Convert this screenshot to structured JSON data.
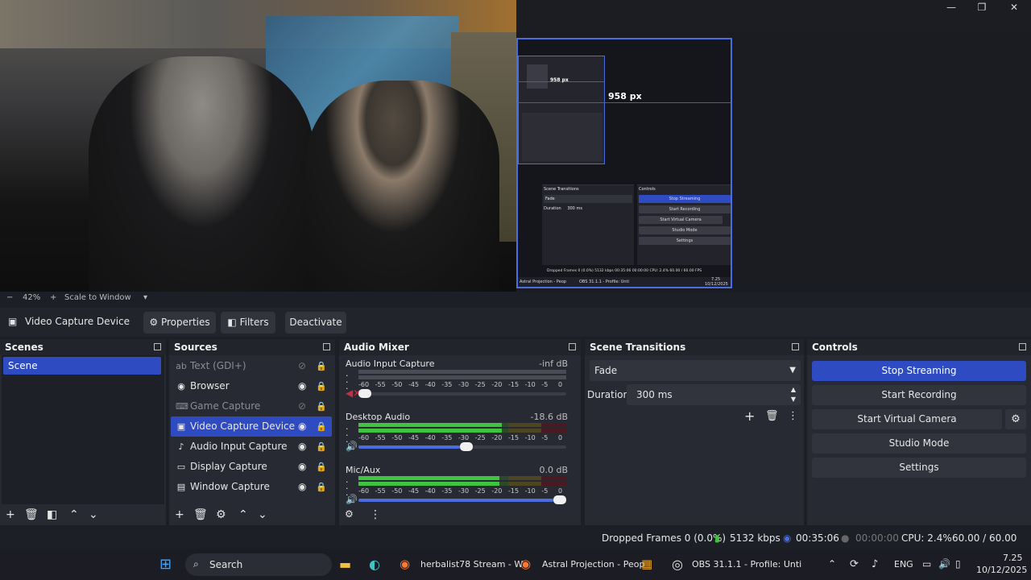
{
  "preview": {
    "nested_px_label": "958 px",
    "nested_px_label_small": "958 px",
    "nested_controls": [
      "Stop Streaming",
      "Start Recording",
      "Start Virtual Camera",
      "Studio Mode",
      "Settings"
    ],
    "nested_transitions_title": "Scene Transitions",
    "nested_controls_title": "Controls",
    "nested_fade": "Fade",
    "nested_duration_label": "Duration",
    "nested_duration": "300 ms",
    "nested_status": "Dropped Frames 0 (0.0%)   5132 kbps   00:35:06   00:00:00   CPU: 2.4%   60.00 / 60.00 FPS",
    "nested_taskbar_left": "Astral Projection - Peop",
    "nested_taskbar_obs": "OBS 31.1.1 - Profile: Unti",
    "nested_clock_time": "7.25",
    "nested_clock_date": "10/12/2025"
  },
  "window_controls": {
    "minimize": "—",
    "maximize": "❐",
    "close": "✕"
  },
  "zoom": {
    "minus": "−",
    "level": "42%",
    "plus": "+",
    "mode": "Scale to Window",
    "dropdown": "▾"
  },
  "source_toolbar": {
    "source_name": "Video Capture Device",
    "properties": "Properties",
    "filters": "Filters",
    "deactivate": "Deactivate"
  },
  "scenes": {
    "title": "Scenes",
    "items": [
      "Scene"
    ]
  },
  "sources": {
    "title": "Sources",
    "items": [
      {
        "label": "Text (GDI+)",
        "icon": "text-icon",
        "glyph": "ab",
        "visible": false,
        "selected": false
      },
      {
        "label": "Browser",
        "icon": "globe-icon",
        "glyph": "◉",
        "visible": true,
        "selected": false
      },
      {
        "label": "Game Capture",
        "icon": "gamepad-icon",
        "glyph": "⌨",
        "visible": false,
        "selected": false
      },
      {
        "label": "Video Capture Device",
        "icon": "camera-icon",
        "glyph": "▣",
        "visible": true,
        "selected": true
      },
      {
        "label": "Audio Input Capture",
        "icon": "microphone-icon",
        "glyph": "🎙",
        "visible": true,
        "selected": false
      },
      {
        "label": "Display Capture",
        "icon": "monitor-icon",
        "glyph": "▭",
        "visible": true,
        "selected": false
      },
      {
        "label": "Window Capture",
        "icon": "window-icon",
        "glyph": "▤",
        "visible": true,
        "selected": false
      }
    ]
  },
  "audio_mixer": {
    "title": "Audio Mixer",
    "ticks": [
      "-60",
      "-55",
      "-50",
      "-45",
      "-40",
      "-35",
      "-30",
      "-25",
      "-20",
      "-15",
      "-10",
      "-5",
      "0"
    ],
    "channels": [
      {
        "name": "Audio Input Capture",
        "db": "-inf dB",
        "level": 0.0,
        "volume": 0.0,
        "muted": true
      },
      {
        "name": "Desktop Audio",
        "db": "-18.6 dB",
        "level": 0.69,
        "volume": 0.52,
        "muted": false
      },
      {
        "name": "Mic/Aux",
        "db": "0.0 dB",
        "level": 0.68,
        "volume": 1.0,
        "muted": false
      }
    ]
  },
  "transitions": {
    "title": "Scene Transitions",
    "selected": "Fade",
    "duration_label": "Duration",
    "duration_value": "300 ms"
  },
  "controls": {
    "title": "Controls",
    "stop_streaming": "Stop Streaming",
    "start_recording": "Start Recording",
    "start_virtual_camera": "Start Virtual Camera",
    "studio_mode": "Studio Mode",
    "settings": "Settings"
  },
  "status": {
    "dropped_frames": "Dropped Frames 0 (0.0%)",
    "bitrate": "5132 kbps",
    "stream_time": "00:35:06",
    "record_time": "00:00:00",
    "cpu": "CPU: 2.4%",
    "fps": "60.00 / 60.00 FPS"
  },
  "taskbar": {
    "search": "Search",
    "app1": "herbalist78 Stream - Wa",
    "app2": "Astral Projection - Peop",
    "app3": "OBS 31.1.1 - Profile: Unti",
    "lang": "ENG",
    "time": "7.25",
    "date": "10/12/2025"
  },
  "colors": {
    "accent": "#2f4bc2",
    "meter_green": "#3ec43e",
    "meter_yellow": "#c8b22a",
    "meter_red": "#b8242e"
  }
}
